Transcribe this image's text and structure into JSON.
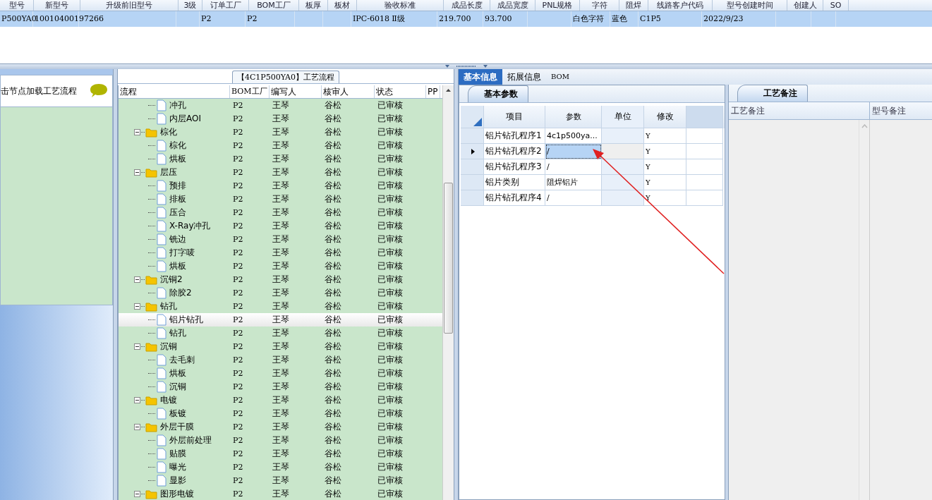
{
  "order_table": {
    "columns": [
      "型号",
      "新型号",
      "升级前旧型号",
      "3级",
      "订单工厂",
      "BOM工厂",
      "板厚",
      "板材",
      "验收标准",
      "成品长度",
      "成品宽度",
      "PNL规格",
      "字符",
      "阻焊",
      "线路客户代码",
      "型号创建时间",
      "创建人",
      "SO"
    ],
    "rows": [
      {
        "selected": true,
        "cells": [
          "P500YA0",
          "10010400197266",
          null,
          null,
          "P2",
          "P2",
          null,
          null,
          "IPC-6018 Ⅱ级",
          "219.700",
          "93.700",
          null,
          "白色字符",
          "蓝色",
          "C1P5",
          "2022/9/23",
          null,
          null
        ]
      }
    ]
  },
  "left_panel": {
    "hint": "击节点加载工艺流程"
  },
  "process_panel": {
    "title": "【4C1P500YA0】工艺流程",
    "columns": [
      "流程",
      "BOM工厂",
      "编写人",
      "核审人",
      "状态",
      "PP"
    ],
    "rows": [
      {
        "kind": "step",
        "name": "冲孔",
        "bom": "P2",
        "writer": "王琴",
        "reviewer": "谷松",
        "status": "已审核",
        "selected": false
      },
      {
        "kind": "step",
        "name": "内层AOI",
        "bom": "P2",
        "writer": "王琴",
        "reviewer": "谷松",
        "status": "已审核",
        "selected": false
      },
      {
        "kind": "folder",
        "name": "棕化",
        "bom": "P2",
        "writer": "王琴",
        "reviewer": "谷松",
        "status": "已审核",
        "selected": false,
        "expanded": true,
        "children": [
          {
            "kind": "step",
            "name": "棕化",
            "bom": "P2",
            "writer": "王琴",
            "reviewer": "谷松",
            "status": "已审核",
            "selected": false
          },
          {
            "kind": "step",
            "name": "烘板",
            "bom": "P2",
            "writer": "王琴",
            "reviewer": "谷松",
            "status": "已审核",
            "selected": false
          }
        ]
      },
      {
        "kind": "folder",
        "name": "层压",
        "bom": "P2",
        "writer": "王琴",
        "reviewer": "谷松",
        "status": "已审核",
        "selected": false,
        "expanded": true,
        "children": [
          {
            "kind": "step",
            "name": "预排",
            "bom": "P2",
            "writer": "王琴",
            "reviewer": "谷松",
            "status": "已审核",
            "selected": false
          },
          {
            "kind": "step",
            "name": "排板",
            "bom": "P2",
            "writer": "王琴",
            "reviewer": "谷松",
            "status": "已审核",
            "selected": false
          },
          {
            "kind": "step",
            "name": "压合",
            "bom": "P2",
            "writer": "王琴",
            "reviewer": "谷松",
            "status": "已审核",
            "selected": false
          },
          {
            "kind": "step",
            "name": "X-Ray冲孔",
            "bom": "P2",
            "writer": "王琴",
            "reviewer": "谷松",
            "status": "已审核",
            "selected": false
          },
          {
            "kind": "step",
            "name": "铣边",
            "bom": "P2",
            "writer": "王琴",
            "reviewer": "谷松",
            "status": "已审核",
            "selected": false
          },
          {
            "kind": "step",
            "name": "打字唛",
            "bom": "P2",
            "writer": "王琴",
            "reviewer": "谷松",
            "status": "已审核",
            "selected": false
          },
          {
            "kind": "step",
            "name": "烘板",
            "bom": "P2",
            "writer": "王琴",
            "reviewer": "谷松",
            "status": "已审核",
            "selected": false
          }
        ]
      },
      {
        "kind": "folder",
        "name": "沉铜2",
        "bom": "P2",
        "writer": "王琴",
        "reviewer": "谷松",
        "status": "已审核",
        "selected": false,
        "expanded": true,
        "children": [
          {
            "kind": "step",
            "name": "除胶2",
            "bom": "P2",
            "writer": "王琴",
            "reviewer": "谷松",
            "status": "已审核",
            "selected": false
          }
        ]
      },
      {
        "kind": "folder",
        "name": "钻孔",
        "bom": "P2",
        "writer": "王琴",
        "reviewer": "谷松",
        "status": "已审核",
        "selected": false,
        "expanded": true,
        "children": [
          {
            "kind": "step",
            "name": "铝片钻孔",
            "bom": "P2",
            "writer": "王琴",
            "reviewer": "谷松",
            "status": "已审核",
            "selected": true
          },
          {
            "kind": "step",
            "name": "钻孔",
            "bom": "P2",
            "writer": "王琴",
            "reviewer": "谷松",
            "status": "已审核",
            "selected": false
          }
        ]
      },
      {
        "kind": "folder",
        "name": "沉铜",
        "bom": "P2",
        "writer": "王琴",
        "reviewer": "谷松",
        "status": "已审核",
        "selected": false,
        "expanded": true,
        "children": [
          {
            "kind": "step",
            "name": "去毛刺",
            "bom": "P2",
            "writer": "王琴",
            "reviewer": "谷松",
            "status": "已审核",
            "selected": false
          },
          {
            "kind": "step",
            "name": "烘板",
            "bom": "P2",
            "writer": "王琴",
            "reviewer": "谷松",
            "status": "已审核",
            "selected": false
          },
          {
            "kind": "step",
            "name": "沉铜",
            "bom": "P2",
            "writer": "王琴",
            "reviewer": "谷松",
            "status": "已审核",
            "selected": false
          }
        ]
      },
      {
        "kind": "folder",
        "name": "电镀",
        "bom": "P2",
        "writer": "王琴",
        "reviewer": "谷松",
        "status": "已审核",
        "selected": false,
        "expanded": true,
        "children": [
          {
            "kind": "step",
            "name": "板镀",
            "bom": "P2",
            "writer": "王琴",
            "reviewer": "谷松",
            "status": "已审核",
            "selected": false
          }
        ]
      },
      {
        "kind": "folder",
        "name": "外层干膜",
        "bom": "P2",
        "writer": "王琴",
        "reviewer": "谷松",
        "status": "已审核",
        "selected": false,
        "expanded": true,
        "children": [
          {
            "kind": "step",
            "name": "外层前处理",
            "bom": "P2",
            "writer": "王琴",
            "reviewer": "谷松",
            "status": "已审核",
            "selected": false
          },
          {
            "kind": "step",
            "name": "贴膜",
            "bom": "P2",
            "writer": "王琴",
            "reviewer": "谷松",
            "status": "已审核",
            "selected": false
          },
          {
            "kind": "step",
            "name": "曝光",
            "bom": "P2",
            "writer": "王琴",
            "reviewer": "谷松",
            "status": "已审核",
            "selected": false
          },
          {
            "kind": "step",
            "name": "显影",
            "bom": "P2",
            "writer": "王琴",
            "reviewer": "谷松",
            "status": "已审核",
            "selected": false
          }
        ]
      },
      {
        "kind": "folder",
        "name": "图形电镀",
        "bom": "P2",
        "writer": "王琴",
        "reviewer": "谷松",
        "status": "已审核",
        "selected": false,
        "expanded": true
      }
    ]
  },
  "detail_tabs": [
    {
      "label": "基本信息",
      "selected": true
    },
    {
      "label": "拓展信息",
      "selected": false
    },
    {
      "label": "BOM",
      "selected": false
    }
  ],
  "basic_params": {
    "title": "基本参数",
    "columns": [
      "项目",
      "参数",
      "单位",
      "修改"
    ],
    "rows": [
      {
        "item": "铝片钻孔程序1",
        "param": "4c1p500ya...",
        "modify": "Y",
        "selected": false
      },
      {
        "item": "铝片钻孔程序2",
        "param": "/",
        "modify": "Y",
        "selected": true
      },
      {
        "item": "铝片钻孔程序3",
        "param": "/",
        "modify": "Y",
        "selected": false
      },
      {
        "item": "铝片类别",
        "param": "阻焊铝片",
        "modify": "Y",
        "selected": false
      },
      {
        "item": "铝片钻孔程序4",
        "param": "/",
        "modify": "Y",
        "selected": false
      }
    ]
  },
  "notes_panel": {
    "title": "工艺备注",
    "columns": [
      "工艺备注",
      "型号备注"
    ]
  }
}
